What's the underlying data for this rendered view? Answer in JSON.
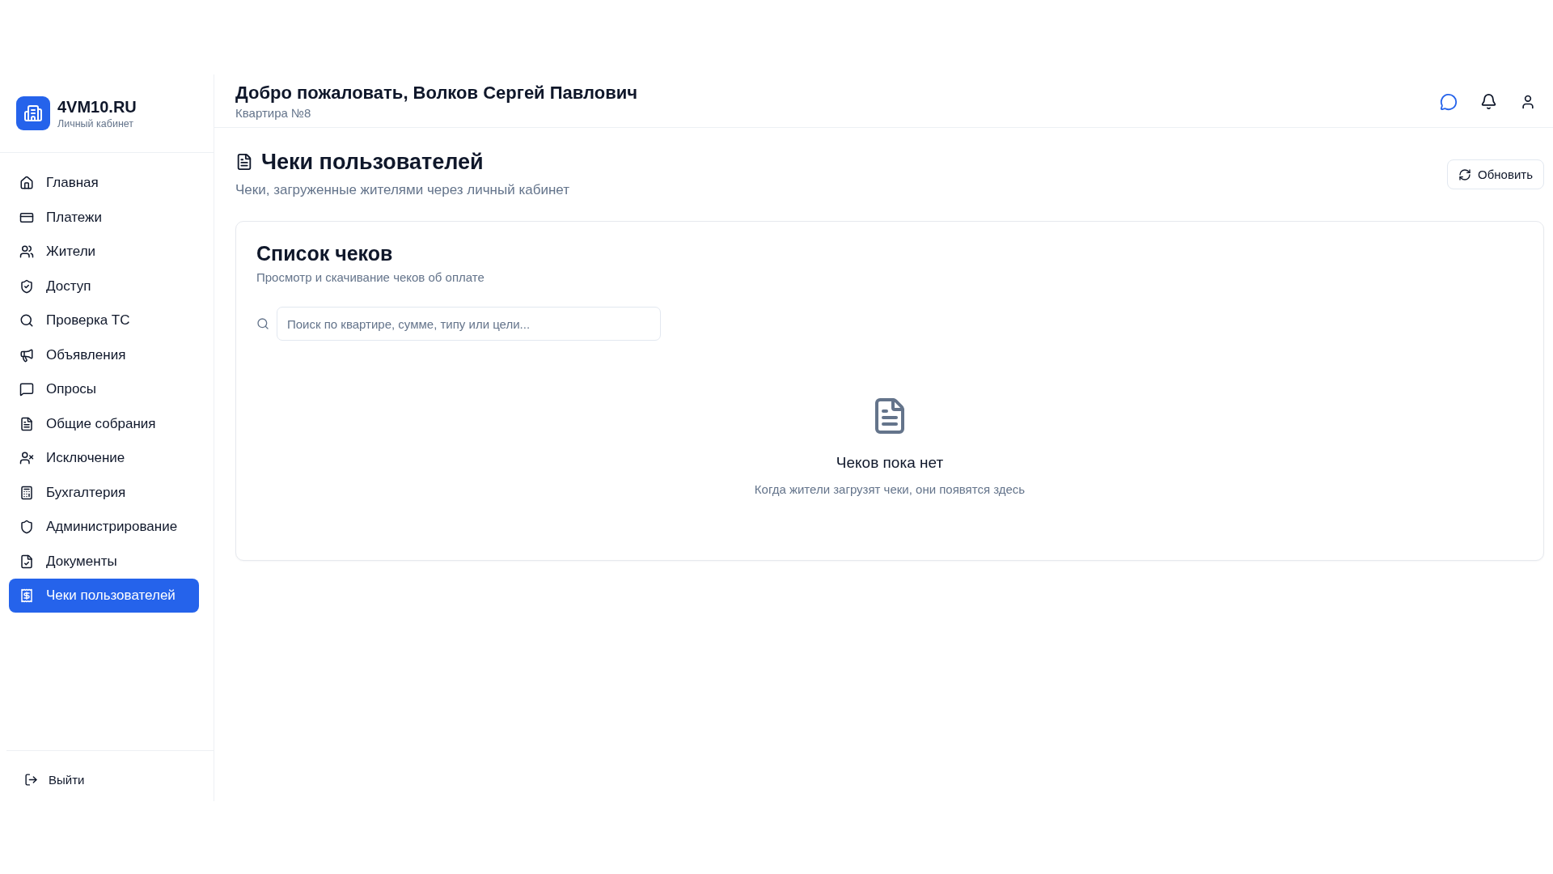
{
  "sidebar": {
    "brand": {
      "title": "4VM10.RU",
      "subtitle": "Личный кабинет"
    },
    "items": [
      {
        "label": "Главная",
        "selected": false
      },
      {
        "label": "Платежи",
        "selected": false
      },
      {
        "label": "Жители",
        "selected": false
      },
      {
        "label": "Доступ",
        "selected": false
      },
      {
        "label": "Проверка ТС",
        "selected": false
      },
      {
        "label": "Объявления",
        "selected": false
      },
      {
        "label": "Опросы",
        "selected": false
      },
      {
        "label": "Общие собрания",
        "selected": false
      },
      {
        "label": "Исключение",
        "selected": false
      },
      {
        "label": "Бухгалтерия",
        "selected": false
      },
      {
        "label": "Администрирование",
        "selected": false
      },
      {
        "label": "Документы",
        "selected": false
      },
      {
        "label": "Чеки пользователей",
        "selected": true
      }
    ],
    "logout": "Выйти"
  },
  "header": {
    "title": "Добро пожаловать, Волков Сергей Павлович",
    "subtitle": "Квартира №8"
  },
  "page": {
    "title": "Чеки пользователей",
    "subtitle": "Чеки, загруженные жителями через личный кабинет",
    "refresh_button": "Обновить"
  },
  "card": {
    "title": "Список чеков",
    "subtitle": "Просмотр и скачивание чеков об оплате",
    "search": {
      "placeholder": "Поиск по квартире, сумме, типу или цели..."
    },
    "empty_state": {
      "title": "Чеков пока нет",
      "text": "Когда жители загрузят чеки, они появятся здесь"
    }
  }
}
